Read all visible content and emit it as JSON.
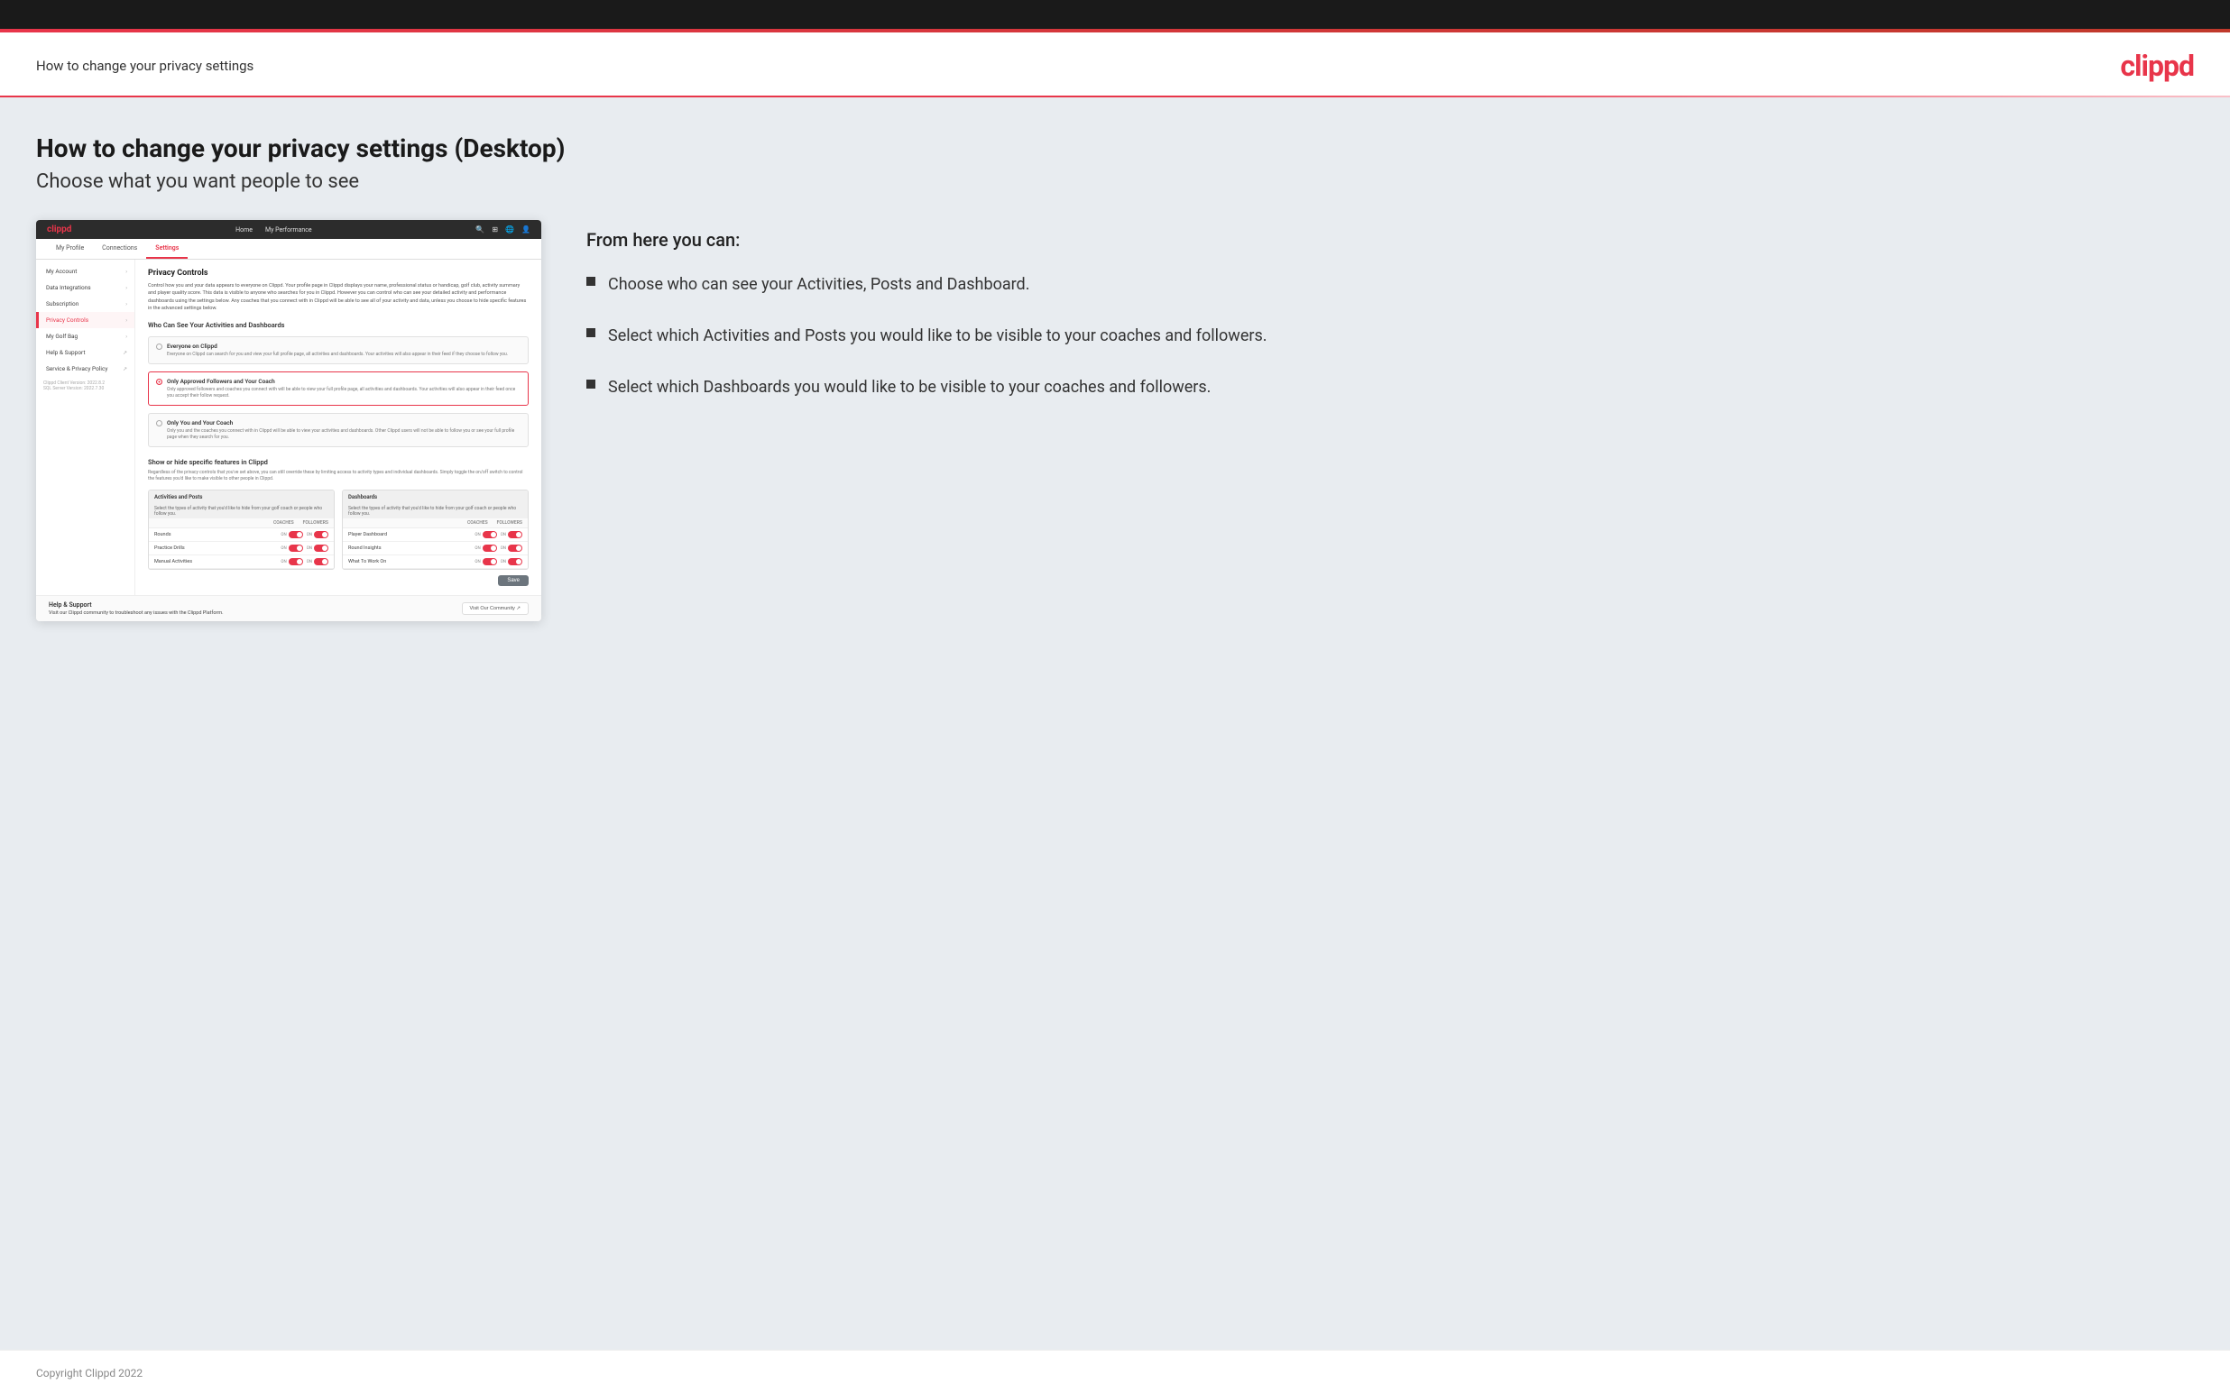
{
  "header": {
    "title": "How to change your privacy settings",
    "logo": "clippd"
  },
  "page": {
    "heading": "How to change your privacy settings (Desktop)",
    "subheading": "Choose what you want people to see"
  },
  "from_here": "From here you can:",
  "bullets": [
    {
      "text": "Choose who can see your Activities, Posts and Dashboard."
    },
    {
      "text": "Select which Activities and Posts you would like to be visible to your coaches and followers."
    },
    {
      "text": "Select which Dashboards you would like to be visible to your coaches and followers."
    }
  ],
  "app_mockup": {
    "navbar": {
      "logo": "clippd",
      "links": [
        "Home",
        "My Performance"
      ],
      "icons": [
        "🔍",
        "⊞",
        "🌐",
        "👤"
      ]
    },
    "subnav": {
      "items": [
        "My Profile",
        "Connections",
        "Settings"
      ],
      "active": "Settings"
    },
    "sidebar": {
      "items": [
        {
          "label": "My Account",
          "active": false
        },
        {
          "label": "Data Integrations",
          "active": false
        },
        {
          "label": "Subscription",
          "active": false
        },
        {
          "label": "Privacy Controls",
          "active": true
        },
        {
          "label": "My Golf Bag",
          "active": false
        },
        {
          "label": "Help & Support",
          "active": false
        },
        {
          "label": "Service & Privacy Policy",
          "active": false
        }
      ]
    },
    "panel": {
      "title": "Privacy Controls",
      "description": "Control how you and your data appears to everyone on Clippd. Your profile page in Clippd displays your name, professional status or handicap, golf club, activity summary and player quality score. This data is visible to anyone who searches for you in Clippd. However you can control who can see your detailed activity and performance dashboards using the settings below. Any coaches that you connect with in Clippd will be able to see all of your activity and data, unless you choose to hide specific features in the advanced settings below.",
      "who_can_see_title": "Who Can See Your Activities and Dashboards",
      "radio_options": [
        {
          "label": "Everyone on Clippd",
          "description": "Everyone on Clippd can search for you and view your full profile page, all activities and dashboards. Your activities will also appear in their feed if they choose to follow you.",
          "selected": false
        },
        {
          "label": "Only Approved Followers and Your Coach",
          "description": "Only approved followers and coaches you connect with will be able to view your full profile page, all activities and dashboards. Your activities will also appear in their feed once you accept their follow request.",
          "selected": true
        },
        {
          "label": "Only You and Your Coach",
          "description": "Only you and the coaches you connect with in Clippd will be able to view your activities and dashboards. Other Clippd users will not be able to follow you or see your full profile page when they search for you.",
          "selected": false
        }
      ],
      "show_hide_title": "Show or hide specific features in Clippd",
      "show_hide_desc": "Regardless of the privacy controls that you've set above, you can still override these by limiting access to activity types and individual dashboards. Simply toggle the on/off switch to control the features you'd like to make visible to other people in Clippd.",
      "activities_posts": {
        "title": "Activities and Posts",
        "subtitle": "Select the types of activity that you'd like to hide from your golf coach or people who follow you.",
        "rows": [
          {
            "label": "Rounds"
          },
          {
            "label": "Practice Drills"
          },
          {
            "label": "Manual Activities"
          }
        ]
      },
      "dashboards": {
        "title": "Dashboards",
        "subtitle": "Select the types of activity that you'd like to hide from your golf coach or people who follow you.",
        "rows": [
          {
            "label": "Player Dashboard"
          },
          {
            "label": "Round Insights"
          },
          {
            "label": "What To Work On"
          }
        ]
      },
      "save_button": "Save",
      "help": {
        "title": "Help & Support",
        "description": "Visit our Clippd community to troubleshoot any issues with the Clippd Platform.",
        "button": "Visit Our Community"
      },
      "version": "Clippd Client Version: 2022.8.2\nSQL Server Version: 2022.7.30"
    }
  },
  "footer": {
    "copyright": "Copyright Clippd 2022"
  }
}
